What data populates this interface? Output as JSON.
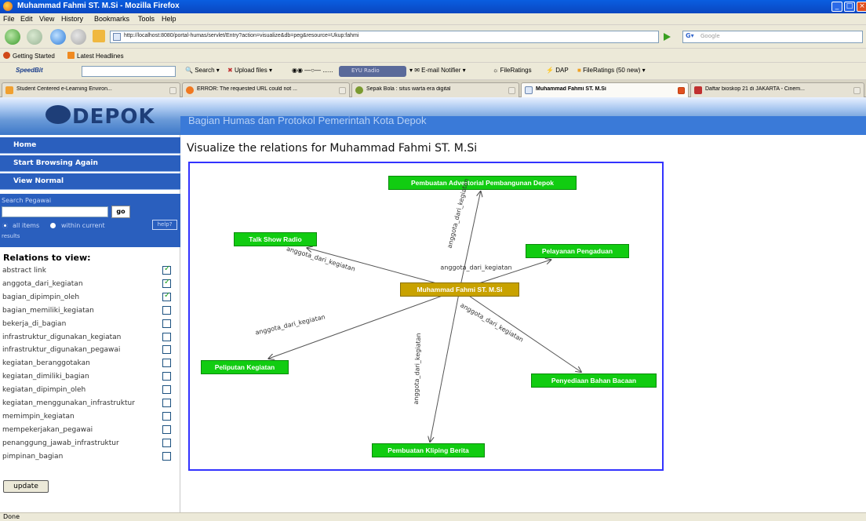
{
  "window": {
    "title": "Muhammad Fahmi ST. M.Si - Mozilla Firefox"
  },
  "menu": [
    "File",
    "Edit",
    "View",
    "History",
    "Bookmarks",
    "Tools",
    "Help"
  ],
  "navigation": {
    "url": "http://localhost:8080/portal-humas/servlet/Entry?action=visualize&db=peg&resource=Ukup:fahmi",
    "search_placeholder": "Google"
  },
  "bookmarks": [
    "Getting Started",
    "Latest Headlines"
  ],
  "speedbit": {
    "logo": "SpeedBit",
    "search": "Search",
    "upload": "Upload files",
    "radio": "EYU Radio",
    "email": "E-mail Notifier",
    "fileratings": "FileRatings",
    "dap": "DAP",
    "fileratings_new": "FileRatings (50 new)"
  },
  "tabs": [
    {
      "label": "Student Centered e-Learning Environ...",
      "active": false
    },
    {
      "label": "ERROR: The requested URL could not ...",
      "active": false
    },
    {
      "label": "Sepak Bola : situs warta era digital",
      "active": false
    },
    {
      "label": "Muhammad Fahmi ST. M.Si",
      "active": true
    },
    {
      "label": "Daftar bioskop 21 di JAKARTA - Cinem...",
      "active": false
    }
  ],
  "banner": {
    "logo_text": "DEPOK",
    "subtitle": "Bagian Humas dan Protokol Pemerintah Kota Depok"
  },
  "sidebar": {
    "links": [
      "Home",
      "Start Browsing Again",
      "View Normal"
    ],
    "search": {
      "label": "Search Pegawai",
      "go": "go",
      "all_items": "all items",
      "within": "within current",
      "results": "results",
      "help": "help?"
    },
    "relations_title": "Relations to view:",
    "relations": [
      {
        "label": "abstract link",
        "checked": true
      },
      {
        "label": "anggota_dari_kegiatan",
        "checked": true
      },
      {
        "label": "bagian_dipimpin_oleh",
        "checked": true
      },
      {
        "label": "bagian_memiliki_kegiatan",
        "checked": false
      },
      {
        "label": "bekerja_di_bagian",
        "checked": false
      },
      {
        "label": "infrastruktur_digunakan_kegiatan",
        "checked": false
      },
      {
        "label": "infrastruktur_digunakan_pegawai",
        "checked": false
      },
      {
        "label": "kegiatan_beranggotakan",
        "checked": false
      },
      {
        "label": "kegiatan_dimiliki_bagian",
        "checked": false
      },
      {
        "label": "kegiatan_dipimpin_oleh",
        "checked": false
      },
      {
        "label": "kegiatan_menggunakan_infrastruktur",
        "checked": false
      },
      {
        "label": "memimpin_kegiatan",
        "checked": false
      },
      {
        "label": "mempekerjakan_pegawai",
        "checked": false
      },
      {
        "label": "penanggung_jawab_infrastruktur",
        "checked": false
      },
      {
        "label": "pimpinan_bagian",
        "checked": false
      }
    ],
    "update": "update"
  },
  "main": {
    "title": "Visualize the relations for Muhammad Fahmi ST. M.Si"
  },
  "graph": {
    "center": "Muhammad Fahmi ST. M.Si",
    "edge_label": "anggota_dari_kegiatan",
    "nodes": [
      "Pembuatan Advertorial Pembangunan Depok",
      "Talk Show Radio",
      "Pelayanan Pengaduan",
      "Peliputan Kegiatan",
      "Penyediaan Bahan Bacaan",
      "Pembuatan Kliping Berita"
    ]
  },
  "status": "Done"
}
